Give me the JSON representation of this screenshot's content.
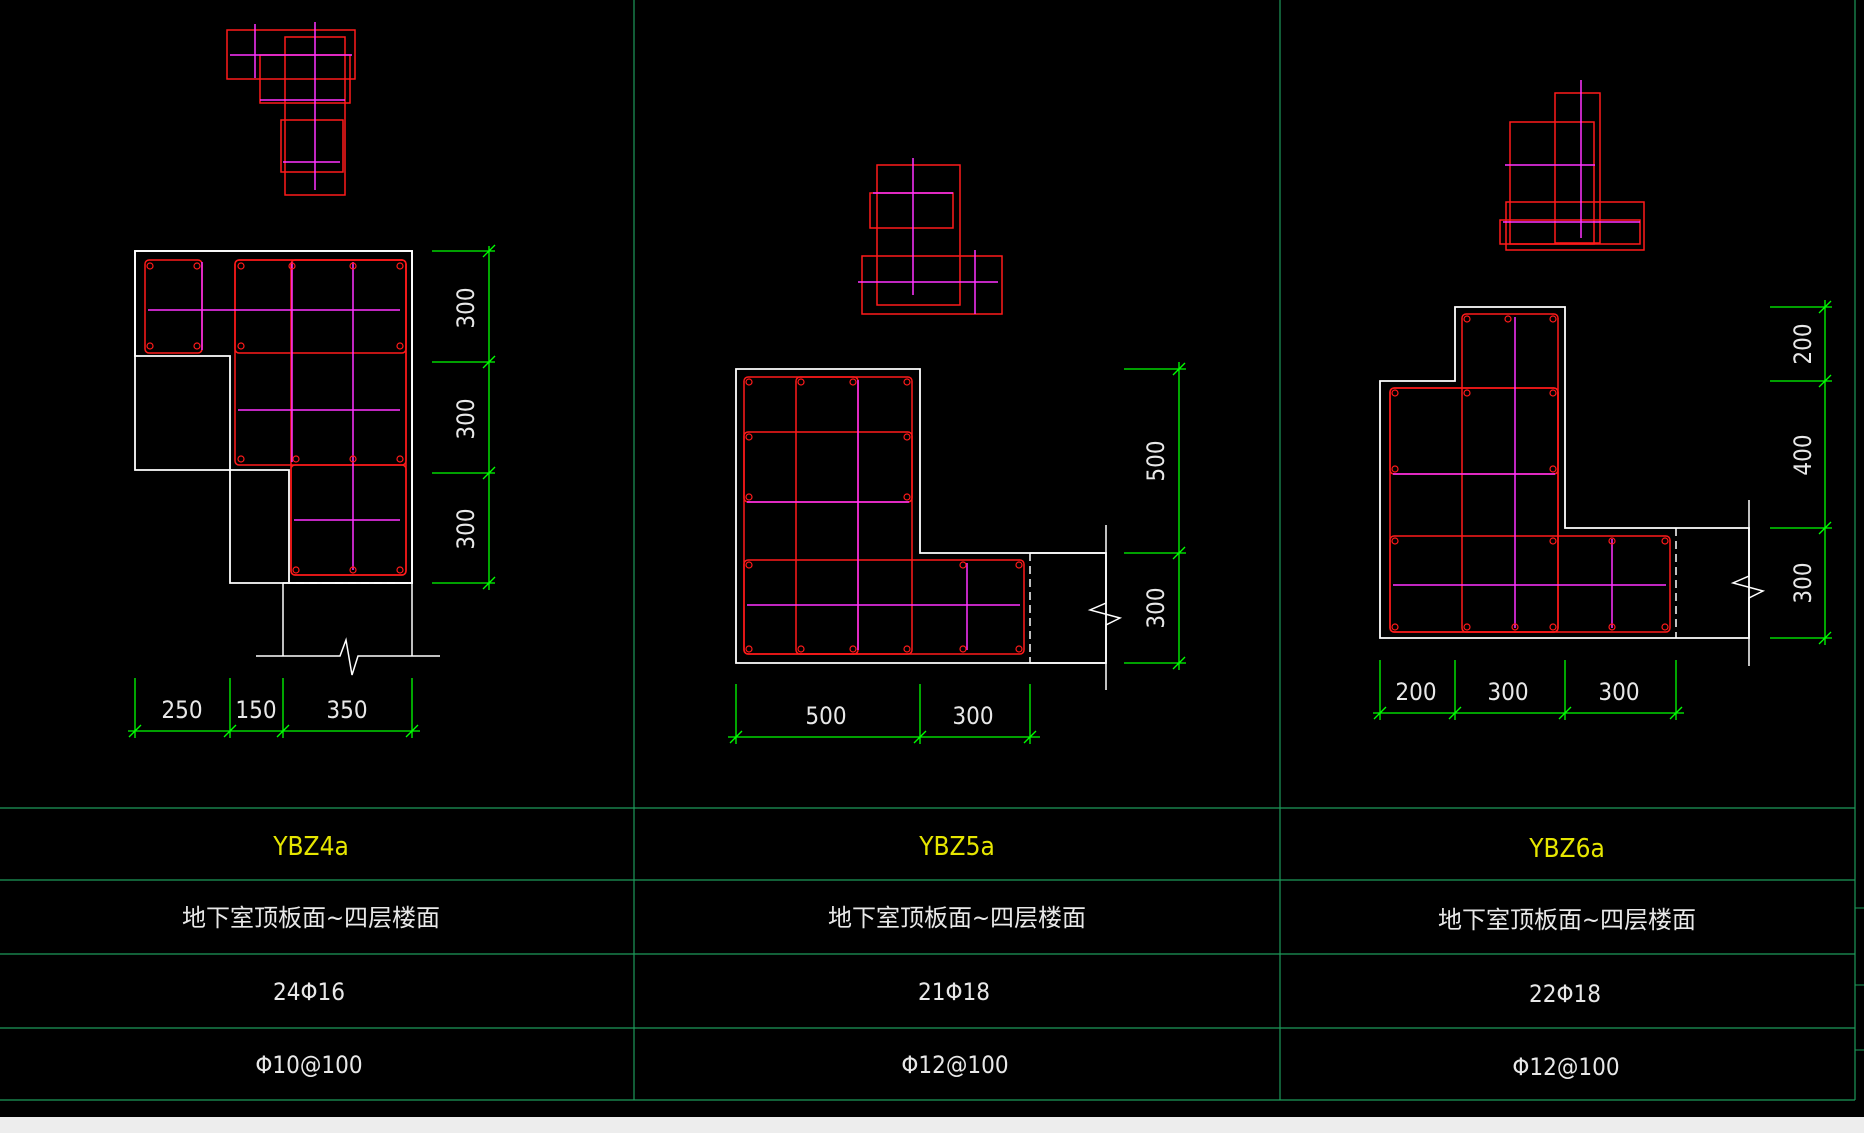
{
  "columns": [
    {
      "name": "YBZ4a",
      "floors": "地下室顶板面~四层楼面",
      "longitudinal": "24Φ16",
      "stirrup": "Φ10@100",
      "dims_h": [
        "250",
        "150",
        "350"
      ],
      "dims_v": [
        "300",
        "300",
        "300"
      ]
    },
    {
      "name": "YBZ5a",
      "floors": "地下室顶板面~四层楼面",
      "longitudinal": "21Φ18",
      "stirrup": "Φ12@100",
      "dims_h": [
        "500",
        "300"
      ],
      "dims_v": [
        "500",
        "300"
      ]
    },
    {
      "name": "YBZ6a",
      "floors": "地下室顶板面~四层楼面",
      "longitudinal": "22Φ18",
      "stirrup": "Φ12@100",
      "dims_h": [
        "200",
        "300",
        "300"
      ],
      "dims_v": [
        "200",
        "400",
        "300"
      ]
    }
  ],
  "colors": {
    "background": "#000000",
    "outline": "#ffffff",
    "stirrup": "#ff1a1a",
    "tie": "#ff33ff",
    "dimension": "#00ff00",
    "grid": "#1d9a5a",
    "name": "#e6e600"
  }
}
